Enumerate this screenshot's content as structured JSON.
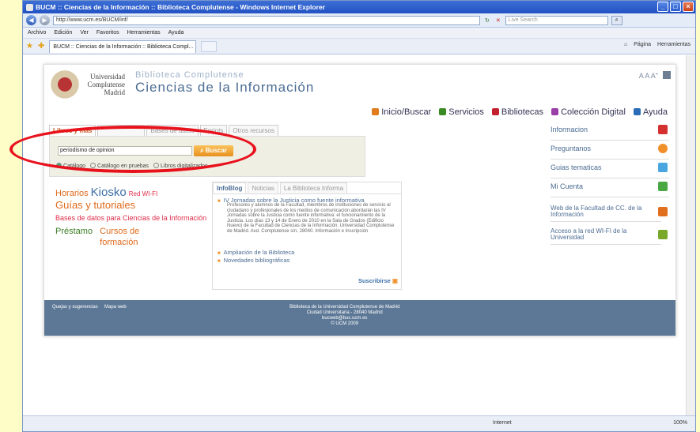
{
  "window": {
    "title": "BUCM :: Ciencias de la Información :: Biblioteca Complutense - Windows Internet Explorer",
    "address": "http://www.ucm.es/BUCM/inf/",
    "live_search_placeholder": "Live Search",
    "menu": [
      "Archivo",
      "Edición",
      "Ver",
      "Favoritos",
      "Herramientas",
      "Ayuda"
    ],
    "tab_title": "BUCM :: Ciencias de la Información :: Biblioteca Compl...",
    "command_bar": [
      "Página",
      "Herramientas"
    ],
    "status_zone": "Internet",
    "zoom": "100%"
  },
  "page": {
    "university": "Universidad Complutense Madrid",
    "library_name": "Biblioteca Complutense",
    "site_title": "Ciencias de la Información",
    "font_size_control": "A A A\"",
    "top_nav": [
      "Inicio/Buscar",
      "Servicios",
      "Bibliotecas",
      "Colección Digital",
      "Ayuda"
    ],
    "search_tabs": [
      "Libros y más",
      "",
      "Bases de datos",
      "Eprints",
      "Otros recursos"
    ],
    "search_value": "periodismo de opinion",
    "search_button": "Buscar",
    "radio_options": [
      "Catálogo",
      "Catálogo en pruebas",
      "Libros digitalizados"
    ],
    "quick_links": {
      "horarios": "Horarios",
      "kiosko": "Kiosko",
      "red_wifi": "Red WI-FI",
      "guias": "Guías y tutoriales",
      "bases": "Bases de datos para Ciencias de la Información",
      "prestamo": "Préstamo",
      "cursos": "Cursos de formación"
    },
    "infoblog_tabs": [
      "InfoBlog",
      "Noticias",
      "La Biblioteca Informa"
    ],
    "posts": [
      "IV Jornadas sobre la Justicia como fuente informativa",
      "Ampliación de la Biblioteca",
      "Novedades bibliográficas"
    ],
    "post_body": "Profesores y alumnos de la Facultad, miembros de instituciones de servicio al ciudadano y profesionales de los medios de comunicación abordarán las IV Jornadas sobre la Justicia como fuente informativa: el funcionamiento de la Justicia. Los días 13 y 14 de Enero de 2010 en la Sala de Grados (Edificio Nuevo) de la Facultad de Ciencias de la Información. Universidad Complutense de Madrid. Avd. Complutense s/n. 28040. Información e Inscripción",
    "subscribe": "Suscribirse",
    "right_items": [
      "Informacion",
      "Preguntanos",
      "Guias tematicas",
      "Mi Cuenta"
    ],
    "right_links": [
      "Web de la Facultad de CC. de la Información",
      "Acceso a la red WI-FI de la Universidad"
    ],
    "footer_links": [
      "Quejas y sugerencias",
      "Mapa web"
    ],
    "footer_address": [
      "Biblioteca de la Universidad Complutense de Madrid",
      "Ciudad Universitaria - 28040 Madrid",
      "bucweb@buc.ucm.es",
      "© UCM 2009"
    ]
  },
  "colors": {
    "annotation": "#e8121d",
    "footer": "#5d7896",
    "accent_orange": "#e06a1c"
  }
}
